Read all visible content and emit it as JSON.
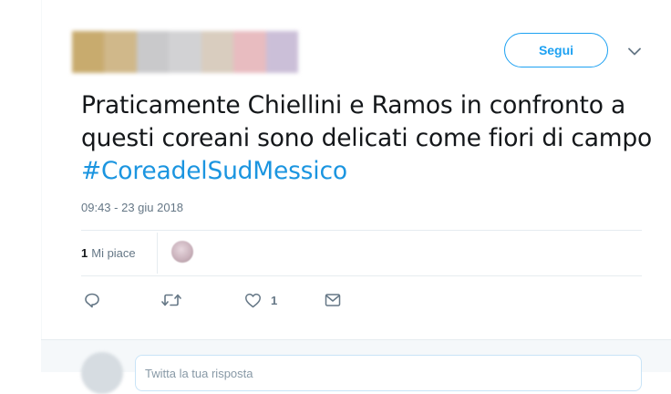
{
  "header": {
    "author_blur_colors": [
      "#c8ab6e",
      "#d0b88a",
      "#c9c9cb",
      "#d2d2d4",
      "#d9cdbf",
      "#e8bcc0",
      "#cbbfd8"
    ],
    "follow_label": "Segui",
    "menu_icon": "chevron-down-icon"
  },
  "tweet": {
    "text_plain": "Praticamente Chiellini e Ramos in confronto a questi coreani sono delicati come fiori di campo",
    "hashtag": "#CoreadelSudMessico",
    "timestamp": "09:43 - 23 giu 2018"
  },
  "stats": {
    "likes_count": "1",
    "likes_label": "Mi piace"
  },
  "actions": {
    "reply_icon": "reply-icon",
    "retweet_icon": "retweet-icon",
    "like_icon": "heart-icon",
    "like_count": "1",
    "dm_icon": "envelope-icon"
  },
  "reply": {
    "placeholder": "Twitta la tua risposta"
  },
  "colors": {
    "accent": "#1da1f2",
    "hashtag": "#1b95e0",
    "muted": "#657786",
    "text": "#14171a"
  }
}
